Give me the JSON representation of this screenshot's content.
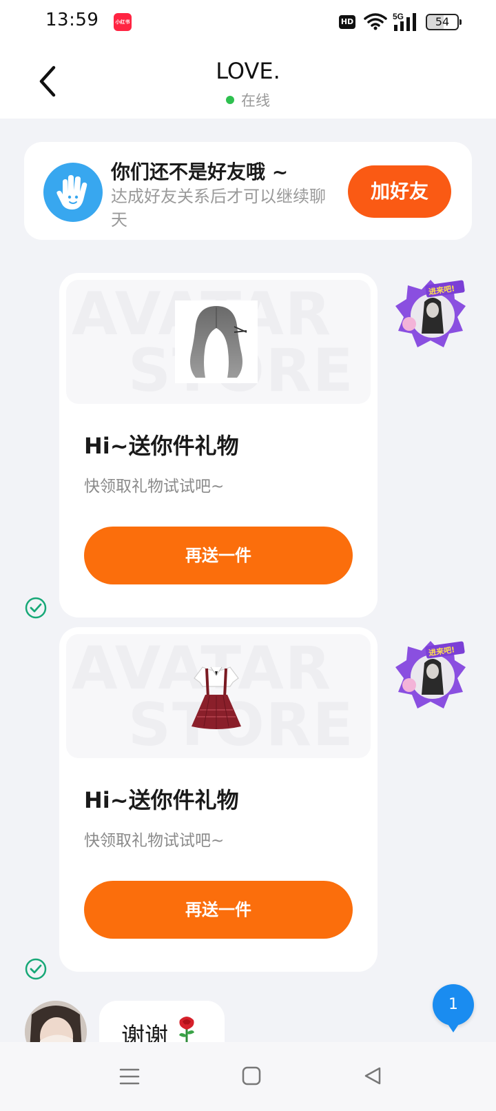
{
  "status_bar": {
    "time": "13:59",
    "app_badge": "小红书",
    "hd": "HD",
    "network": "5G",
    "battery": "54"
  },
  "header": {
    "title": "LOVE.",
    "status": "在线",
    "status_color": "#2ec04f"
  },
  "friend_banner": {
    "title": "你们还不是好友哦 ~",
    "subtitle": "达成好友关系后才可以继续聊天",
    "button": "加好友",
    "accent": "#fa5a14"
  },
  "gift_cards": [
    {
      "item": "wig",
      "watermark_top": "AVATAR",
      "watermark_bottom": "STORE",
      "title": "Hi~送你件礼物",
      "subtitle": "快领取礼物试试吧~",
      "button": "再送一件"
    },
    {
      "item": "dress",
      "watermark_top": "AVATAR",
      "watermark_bottom": "STORE",
      "title": "Hi~送你件礼物",
      "subtitle": "快领取礼物试试吧~",
      "button": "再送一件"
    }
  ],
  "sender_avatar_sticker": "进来吧!",
  "message": {
    "text": "谢谢",
    "emoji": "rose-icon"
  },
  "unread_count": "1",
  "colors": {
    "primary_orange": "#fb6e0c",
    "badge_blue": "#1a8cf0",
    "check_green": "#17a877"
  }
}
